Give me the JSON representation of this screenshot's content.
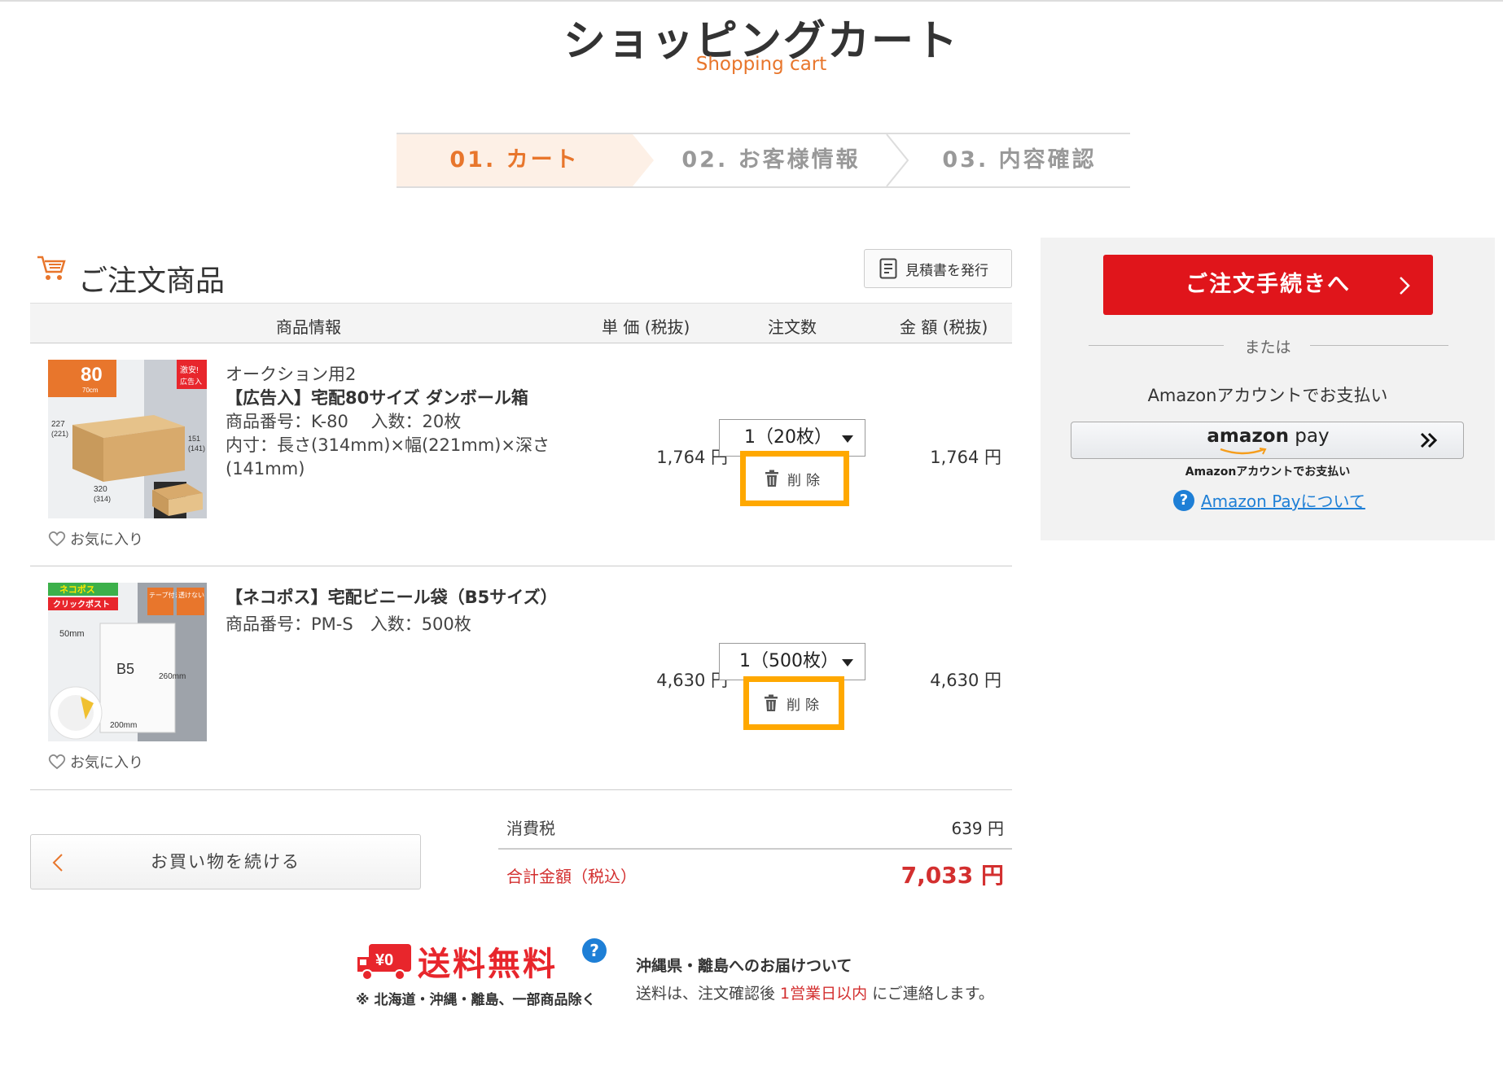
{
  "header": {
    "title": "ショッピングカート",
    "subtitle": "Shopping cart"
  },
  "steps": [
    {
      "label": "01. カート"
    },
    {
      "label": "02. お客様情報"
    },
    {
      "label": "03. 内容確認"
    }
  ],
  "section": {
    "title": "ご注文商品",
    "estimate_button": "見積書を発行"
  },
  "table": {
    "headers": {
      "product": "商品情報",
      "unit_price": "単 価 (税抜)",
      "quantity": "注文数",
      "amount": "金 額 (税抜)"
    }
  },
  "items": [
    {
      "image_labels": {
        "badge_size": "80",
        "badge_text": "宅配\nサイズ",
        "badge_left": "70cm",
        "tag": "激安!",
        "tag2": "広告入",
        "dim1": "227",
        "dim1b": "(221)",
        "dim2": "320",
        "dim2b": "(314)",
        "dim3": "151",
        "dim3b": "(141)"
      },
      "subtitle": "オークション用2",
      "name": "【広告入】宅配80サイズ ダンボール箱",
      "code": "商品番号：K-80　 入数：20枚",
      "dims": "内寸：長さ(314mm)×幅(221mm)×深さ(141mm)",
      "price": "1,764 円",
      "quantity": "1（20枚）",
      "delete_label": "削除",
      "amount": "1,764 円",
      "favorite": "お気に入り"
    },
    {
      "image_labels": {
        "brand": "ネコポス",
        "brand2": "クリックポスト",
        "tag": "テープ付き",
        "tag2": "透けない",
        "size": "B5",
        "w": "50mm",
        "h": "260mm",
        "b": "200mm"
      },
      "subtitle": "",
      "name": "【ネコポス】宅配ビニール袋（B5サイズ）",
      "code": "商品番号：PM-S　入数：500枚",
      "dims": "",
      "price": "4,630 円",
      "quantity": "1（500枚）",
      "delete_label": "削除",
      "amount": "4,630 円",
      "favorite": "お気に入り"
    }
  ],
  "summary": {
    "continue_button": "お買い物を続ける",
    "tax_label": "消費税",
    "tax_value": "639 円",
    "total_label": "合計金額（税込）",
    "total_value": "7,033 円"
  },
  "shipping": {
    "badge": "¥0",
    "title": "送料無料",
    "note": "※ 北海道・沖縄・離島、一部商品除く",
    "help": "?",
    "okinawa_title": "沖縄県・離島へのお届けついて",
    "okinawa_text_1": "送料は、注文確認後 ",
    "okinawa_text_red": "1営業日以内",
    "okinawa_text_2": " にご連絡します。"
  },
  "side": {
    "checkout_button": "ご注文手続きへ",
    "or_text": "または",
    "amazon_caption": "Amazonアカウントでお支払い",
    "amazon_logo_bold": "amazon",
    "amazon_logo_rest": " pay",
    "amazon_sub": "Amazonアカウントでお支払い",
    "amazon_about": "Amazon Payについて"
  },
  "colors": {
    "accent_orange": "#e8762c",
    "checkout_red": "#e0151b",
    "highlight_yellow": "#ffa800",
    "total_red": "#d32f2f",
    "link_blue": "#1e7fd6"
  }
}
